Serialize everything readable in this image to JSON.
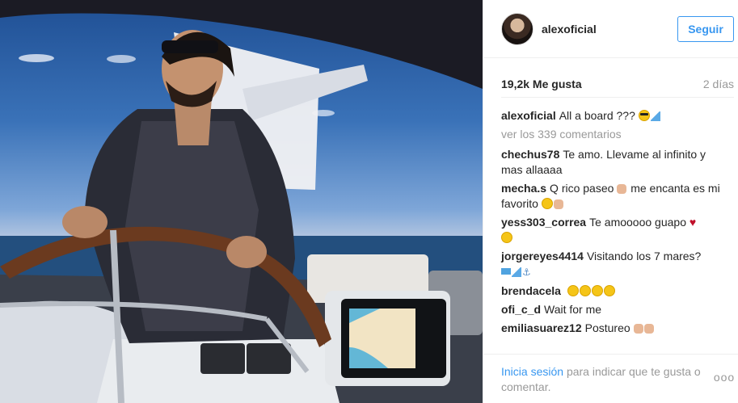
{
  "post": {
    "username": "alexoficial",
    "follow_label": "Seguir",
    "likes": "19,2k Me gusta",
    "date": "2 días",
    "caption": {
      "user": "alexoficial",
      "text": "All a board ???"
    },
    "view_all": "ver los 339 comentarios",
    "comments": [
      {
        "user": "chechus78",
        "text": "Te amo. Llevame al infinito y mas allaaaa"
      },
      {
        "user": "mecha.s",
        "text": "Q rico paseo",
        "text2": "me encanta es mi favorito"
      },
      {
        "user": "yess303_correa",
        "text": "Te amooooo guapo"
      },
      {
        "user": "jorgereyes4414",
        "text": "Visitando los 7 mares?"
      },
      {
        "user": "brendacela",
        "text": ""
      },
      {
        "user": "ofi_c_d",
        "text": "Wait for me"
      },
      {
        "user": "emiliasuarez12",
        "text": "Postureo"
      }
    ],
    "footer": {
      "login_link": "Inicia sesión",
      "login_rest": "para indicar que te gusta o comentar.",
      "more_icon": "ooo"
    }
  },
  "icons": {
    "avatar": "profile-avatar",
    "more": "ellipsis-icon"
  },
  "colors": {
    "link_blue": "#3897f0",
    "text": "#262626",
    "muted": "#999999",
    "border": "#efefef"
  }
}
